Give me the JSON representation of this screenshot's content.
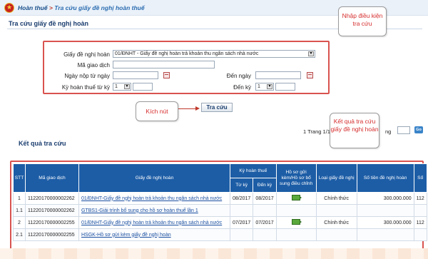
{
  "header": {
    "breadcrumb_root": "Hoàn thuế",
    "breadcrumb_sep": " > ",
    "breadcrumb_current": "Tra cứu giấy đề nghị hoàn thuế"
  },
  "search_section": {
    "title": "Tra cứu giấy đề nghị hoàn",
    "doc_label": "Giấy đề nghị hoàn",
    "doc_value": "01/ĐNHT - Giấy đề nghị hoàn trả khoản thu ngân sách nhà nước",
    "code_label": "Mã giao dịch",
    "code_value": "",
    "from_date_label": "Ngày nộp từ ngày",
    "from_date_value": "",
    "to_date_label": "Đến ngày",
    "to_date_value": "",
    "period_from_label": "Kỳ hoàn thuế từ kỳ",
    "period_from_value": "1",
    "period_to_label": "Đến kỳ",
    "period_to_value": "1",
    "search_button": "Tra cứu"
  },
  "callouts": {
    "input_hint": "Nhập điều kiện tra cứu",
    "click_hint": "Kích nút",
    "result_hint": "Kết quả tra cứu giấy đề nghị hoàn"
  },
  "results": {
    "title": "Kết quả tra cứu",
    "pager_prefix": "1 Trang 1/1",
    "pager_suffix": "ng",
    "go_label": "Go",
    "columns": {
      "stt": "STT",
      "code": "Mã giao dịch",
      "doc": "Giấy đề nghị hoàn",
      "period": "Kỳ hoàn thuế",
      "period_from": "Từ kỳ",
      "period_to": "Đến kỳ",
      "attach": "Hồ sơ gửi kèm/Hồ sơ bổ sung điều chỉnh",
      "type": "Loại giấy đề nghị",
      "amount": "Số tiền đề nghị hoàn",
      "extra": "Số"
    },
    "rows": [
      {
        "stt": "1",
        "code": "11220170000002262",
        "doc": "01/ĐNHT-Giấy đề nghị hoàn trả khoản thu ngân sách nhà nước",
        "from": "08/2017",
        "to": "08/2017",
        "type": "Chính thức",
        "amount": "300.000.000",
        "extra": "112"
      },
      {
        "stt": "1.1",
        "code": "11220170000002262",
        "doc": "GTBS1-Giải trình bổ sung cho hồ sơ hoàn thuế lần 1"
      },
      {
        "stt": "2",
        "code": "11220170000002255",
        "doc": "01/ĐNHT-Giấy đề nghị hoàn trả khoản thu ngân sách nhà nước",
        "from": "07/2017",
        "to": "07/2017",
        "type": "Chính thức",
        "amount": "300.000.000",
        "extra": "112"
      },
      {
        "stt": "2.1",
        "code": "11220170000002255",
        "doc": "HSGK-Hồ sơ gửi kèm giấy đề nghị hoàn"
      }
    ]
  },
  "colors": {
    "header_blue": "#1d5da6",
    "callout_red": "#d62c2c",
    "frame_red": "#d9534f"
  },
  "icons": [
    "emblem-icon",
    "calendar-icon",
    "dropdown-arrow-icon",
    "go-icon",
    "attachment-icon"
  ]
}
